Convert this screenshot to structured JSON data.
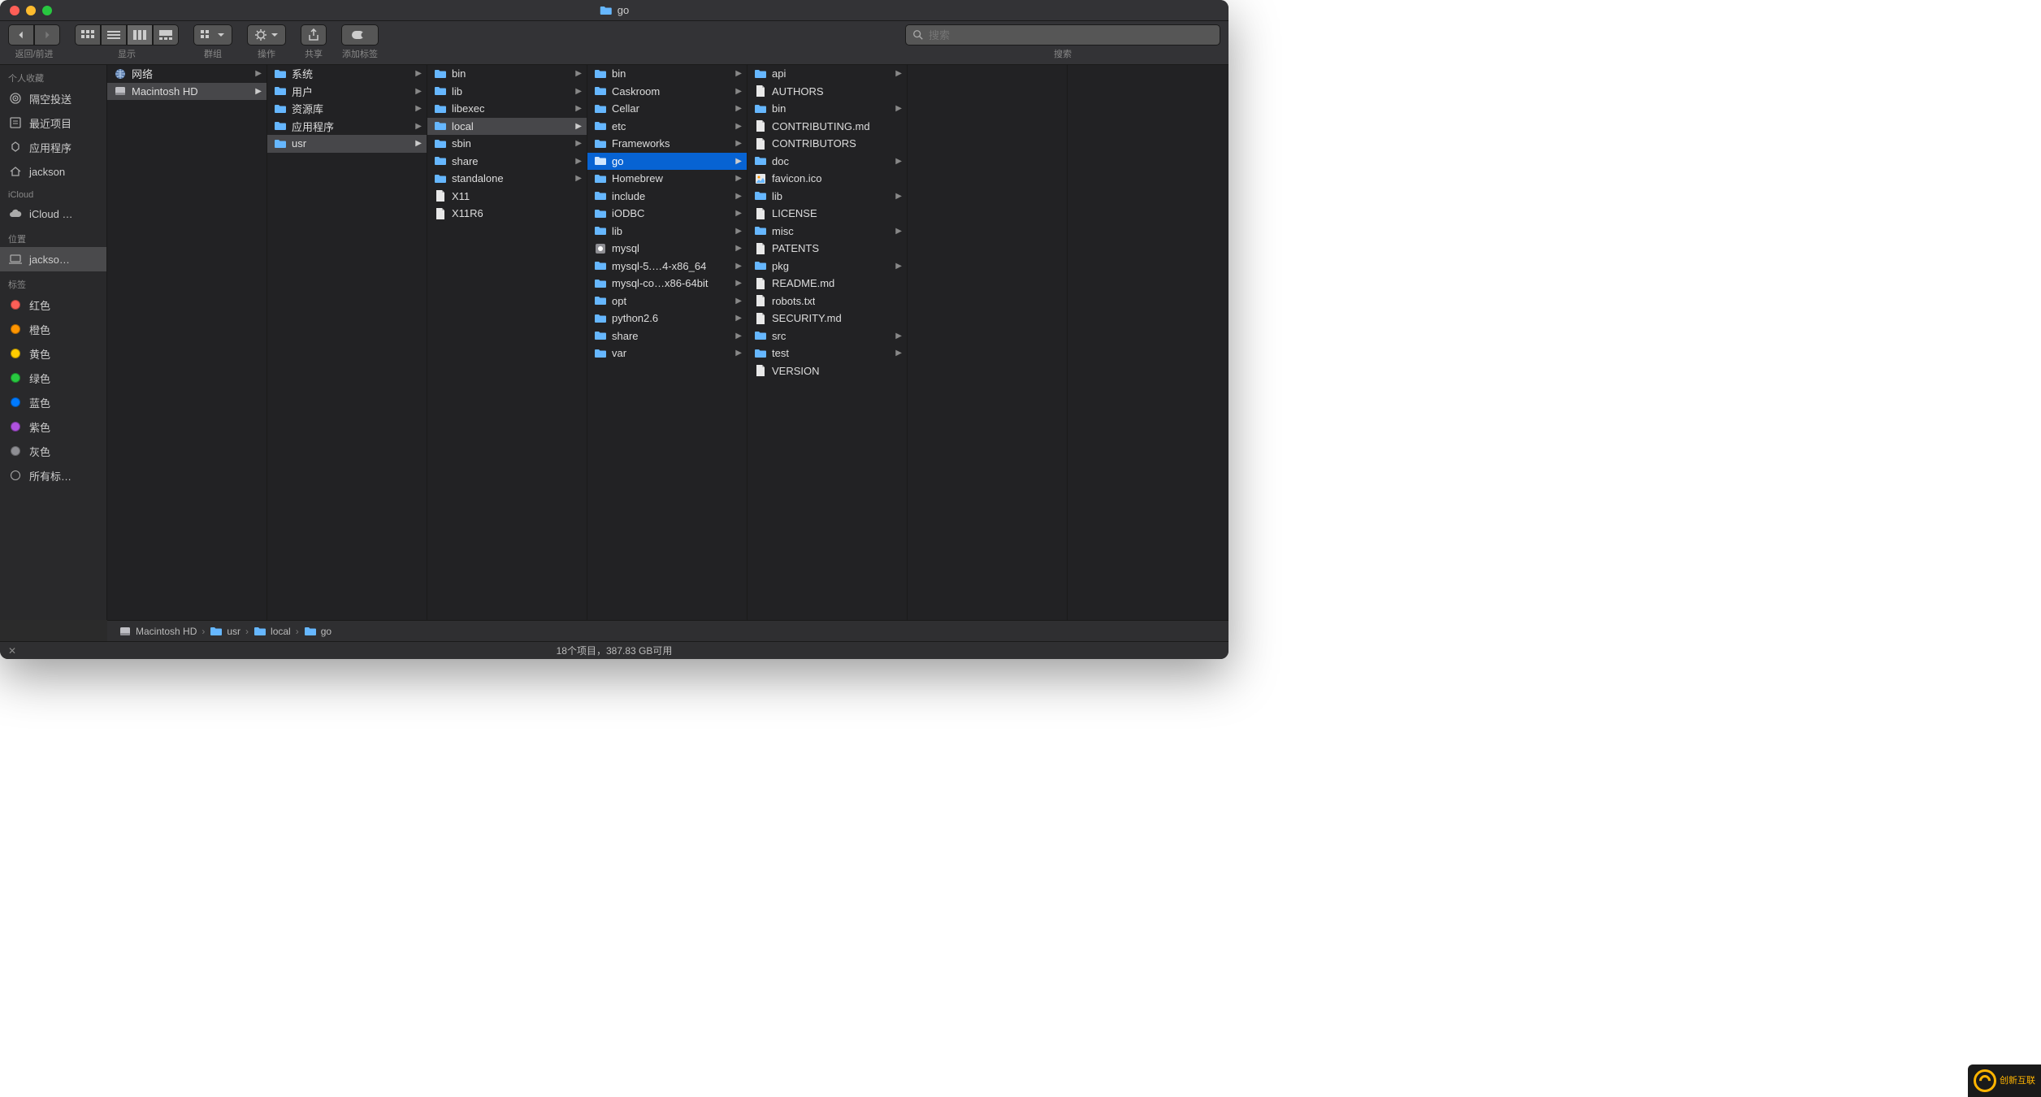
{
  "window": {
    "title": "go"
  },
  "toolbar": {
    "nav_label": "返回/前进",
    "view_label": "显示",
    "group_label": "群组",
    "action_label": "操作",
    "share_label": "共享",
    "tags_label": "添加标签",
    "search_label": "搜索",
    "search_placeholder": "搜索"
  },
  "sidebar": {
    "sections": [
      {
        "title": "个人收藏",
        "items": [
          {
            "icon": "airdrop",
            "label": "隔空投送"
          },
          {
            "icon": "recents",
            "label": "最近项目"
          },
          {
            "icon": "apps",
            "label": "应用程序"
          },
          {
            "icon": "home",
            "label": "jackson"
          }
        ]
      },
      {
        "title": "iCloud",
        "items": [
          {
            "icon": "cloud",
            "label": "iCloud …"
          }
        ]
      },
      {
        "title": "位置",
        "items": [
          {
            "icon": "laptop",
            "label": "jackso…",
            "selected": true
          }
        ]
      },
      {
        "title": "标签",
        "items": [
          {
            "icon": "tag",
            "color": "#ff5f57",
            "label": "红色"
          },
          {
            "icon": "tag",
            "color": "#ff9500",
            "label": "橙色"
          },
          {
            "icon": "tag",
            "color": "#ffcc00",
            "label": "黄色"
          },
          {
            "icon": "tag",
            "color": "#28c840",
            "label": "绿色"
          },
          {
            "icon": "tag",
            "color": "#007aff",
            "label": "蓝色"
          },
          {
            "icon": "tag",
            "color": "#af52de",
            "label": "紫色"
          },
          {
            "icon": "tag",
            "color": "#8e8e93",
            "label": "灰色"
          },
          {
            "icon": "tagall",
            "label": "所有标…"
          }
        ]
      }
    ]
  },
  "columns": [
    {
      "items": [
        {
          "icon": "globe",
          "name": "网络",
          "dir": true
        },
        {
          "icon": "disk",
          "name": "Macintosh HD",
          "dir": true,
          "path": true
        }
      ]
    },
    {
      "items": [
        {
          "icon": "sysfolder",
          "name": "系统",
          "dir": true
        },
        {
          "icon": "folder",
          "name": "用户",
          "dir": true
        },
        {
          "icon": "folder",
          "name": "资源库",
          "dir": true
        },
        {
          "icon": "folder",
          "name": "应用程序",
          "dir": true
        },
        {
          "icon": "folder",
          "name": "usr",
          "dir": true,
          "path": true
        }
      ]
    },
    {
      "items": [
        {
          "icon": "folder",
          "name": "bin",
          "dir": true
        },
        {
          "icon": "folder",
          "name": "lib",
          "dir": true
        },
        {
          "icon": "folder",
          "name": "libexec",
          "dir": true
        },
        {
          "icon": "folder",
          "name": "local",
          "dir": true,
          "path": true
        },
        {
          "icon": "folder",
          "name": "sbin",
          "dir": true
        },
        {
          "icon": "folder",
          "name": "share",
          "dir": true
        },
        {
          "icon": "folder",
          "name": "standalone",
          "dir": true
        },
        {
          "icon": "file",
          "name": "X11",
          "dir": false
        },
        {
          "icon": "file",
          "name": "X11R6",
          "dir": false
        }
      ]
    },
    {
      "items": [
        {
          "icon": "folder",
          "name": "bin",
          "dir": true
        },
        {
          "icon": "folder",
          "name": "Caskroom",
          "dir": true
        },
        {
          "icon": "folder",
          "name": "Cellar",
          "dir": true
        },
        {
          "icon": "folder",
          "name": "etc",
          "dir": true
        },
        {
          "icon": "folder",
          "name": "Frameworks",
          "dir": true
        },
        {
          "icon": "folder",
          "name": "go",
          "dir": true,
          "selected": true
        },
        {
          "icon": "folder",
          "name": "Homebrew",
          "dir": true
        },
        {
          "icon": "folder",
          "name": "include",
          "dir": true
        },
        {
          "icon": "folder",
          "name": "iODBC",
          "dir": true
        },
        {
          "icon": "folder",
          "name": "lib",
          "dir": true
        },
        {
          "icon": "app",
          "name": "mysql",
          "dir": true
        },
        {
          "icon": "folder",
          "name": "mysql-5.…4-x86_64",
          "dir": true
        },
        {
          "icon": "folder",
          "name": "mysql-co…x86-64bit",
          "dir": true
        },
        {
          "icon": "folder",
          "name": "opt",
          "dir": true
        },
        {
          "icon": "folder",
          "name": "python2.6",
          "dir": true
        },
        {
          "icon": "folder",
          "name": "share",
          "dir": true
        },
        {
          "icon": "folder",
          "name": "var",
          "dir": true
        }
      ]
    },
    {
      "items": [
        {
          "icon": "folder",
          "name": "api",
          "dir": true
        },
        {
          "icon": "file",
          "name": "AUTHORS",
          "dir": false
        },
        {
          "icon": "folder",
          "name": "bin",
          "dir": true
        },
        {
          "icon": "file",
          "name": "CONTRIBUTING.md",
          "dir": false
        },
        {
          "icon": "file",
          "name": "CONTRIBUTORS",
          "dir": false
        },
        {
          "icon": "folder",
          "name": "doc",
          "dir": true
        },
        {
          "icon": "image",
          "name": "favicon.ico",
          "dir": false
        },
        {
          "icon": "folder",
          "name": "lib",
          "dir": true
        },
        {
          "icon": "file",
          "name": "LICENSE",
          "dir": false
        },
        {
          "icon": "folder",
          "name": "misc",
          "dir": true
        },
        {
          "icon": "file",
          "name": "PATENTS",
          "dir": false
        },
        {
          "icon": "folder",
          "name": "pkg",
          "dir": true
        },
        {
          "icon": "file",
          "name": "README.md",
          "dir": false
        },
        {
          "icon": "file",
          "name": "robots.txt",
          "dir": false
        },
        {
          "icon": "file",
          "name": "SECURITY.md",
          "dir": false
        },
        {
          "icon": "folder",
          "name": "src",
          "dir": true
        },
        {
          "icon": "folder",
          "name": "test",
          "dir": true
        },
        {
          "icon": "file",
          "name": "VERSION",
          "dir": false
        }
      ]
    },
    {
      "items": []
    }
  ],
  "pathbar": [
    {
      "icon": "disk",
      "name": "Macintosh HD"
    },
    {
      "icon": "folder",
      "name": "usr"
    },
    {
      "icon": "folder",
      "name": "local"
    },
    {
      "icon": "folder",
      "name": "go"
    }
  ],
  "status": {
    "text": "18个项目，387.83 GB可用"
  },
  "watermark": {
    "text": "创新互联"
  }
}
